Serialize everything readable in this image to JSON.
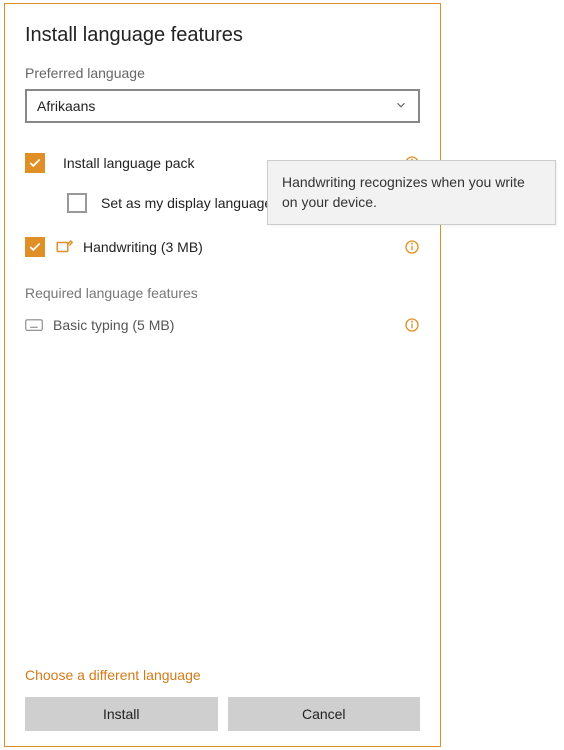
{
  "title": "Install language features",
  "preferred_label": "Preferred language",
  "dropdown": {
    "value": "Afrikaans"
  },
  "features": {
    "install_pack": {
      "label": "Install language pack"
    },
    "display_lang": {
      "label": "Set as my display language"
    },
    "handwriting": {
      "label": "Handwriting (3 MB)"
    }
  },
  "required_label": "Required language features",
  "required": {
    "basic_typing": {
      "label": "Basic typing (5 MB)"
    }
  },
  "tooltip": {
    "text": "Handwriting recognizes when you write on your device."
  },
  "link": {
    "label": "Choose a different language"
  },
  "buttons": {
    "install": "Install",
    "cancel": "Cancel"
  }
}
